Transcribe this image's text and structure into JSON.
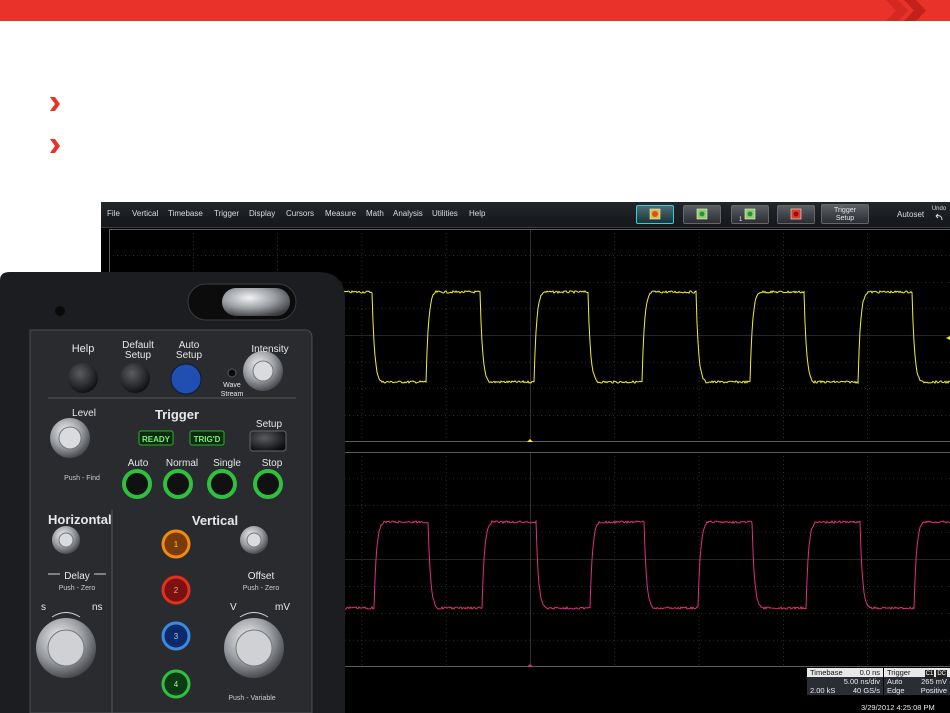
{
  "colors": {
    "accent": "#e8322a",
    "ch1_trace": "#f4f02a",
    "ch2_trace": "#e0307a",
    "scope_bg": "#000000",
    "grid": "#4a4d52"
  },
  "icons": [
    "chevron-right-icon",
    "brand-chevrons-icon",
    "single-grid-icon",
    "dual-grid-icon",
    "quad-grid-icon",
    "stop-icon",
    "undo-icon",
    "trigger-marker-icon"
  ],
  "scope": {
    "menu": [
      "File",
      "Vertical",
      "Timebase",
      "Trigger",
      "Display",
      "Cursors",
      "Measure",
      "Math",
      "Analysis",
      "Utilities",
      "Help"
    ],
    "trigger_setup_line1": "Trigger",
    "trigger_setup_line2": "Setup",
    "autoset_label": "Autoset",
    "undo_label": "Undo",
    "timebase": {
      "header": "Timebase",
      "delay": "0.0 ns",
      "per_div": "5.00 ns/div",
      "samples": "2.00 kS",
      "rate": "40 GS/s"
    },
    "trigger": {
      "header": "Trigger",
      "source": "C1",
      "coupling": "DC",
      "mode": "Auto",
      "level": "265 mV",
      "type": "Edge",
      "slope": "Positive"
    },
    "datetime": "3/29/2012 4:25:08 PM"
  },
  "panel": {
    "help": "Help",
    "default_setup_1": "Default",
    "default_setup_2": "Setup",
    "auto_setup_1": "Auto",
    "auto_setup_2": "Setup",
    "intensity": "Intensity",
    "wave_stream_1": "Wave",
    "wave_stream_2": "Stream",
    "trigger_title": "Trigger",
    "level": "Level",
    "setup": "Setup",
    "ready": "READY",
    "trigd": "TRIG'D",
    "auto": "Auto",
    "normal": "Normal",
    "single": "Single",
    "stop": "Stop",
    "push_find": "Push - Find",
    "horizontal": "Horizontal",
    "vertical": "Vertical",
    "delay": "Delay",
    "push_zero": "Push - Zero",
    "offset": "Offset",
    "push_zero_2": "Push - Zero",
    "s": "s",
    "ns": "ns",
    "v": "V",
    "mv": "mV",
    "push_variable": "Push - Variable",
    "ch1": "1",
    "ch2": "2",
    "ch3": "3",
    "ch4": "4"
  }
}
